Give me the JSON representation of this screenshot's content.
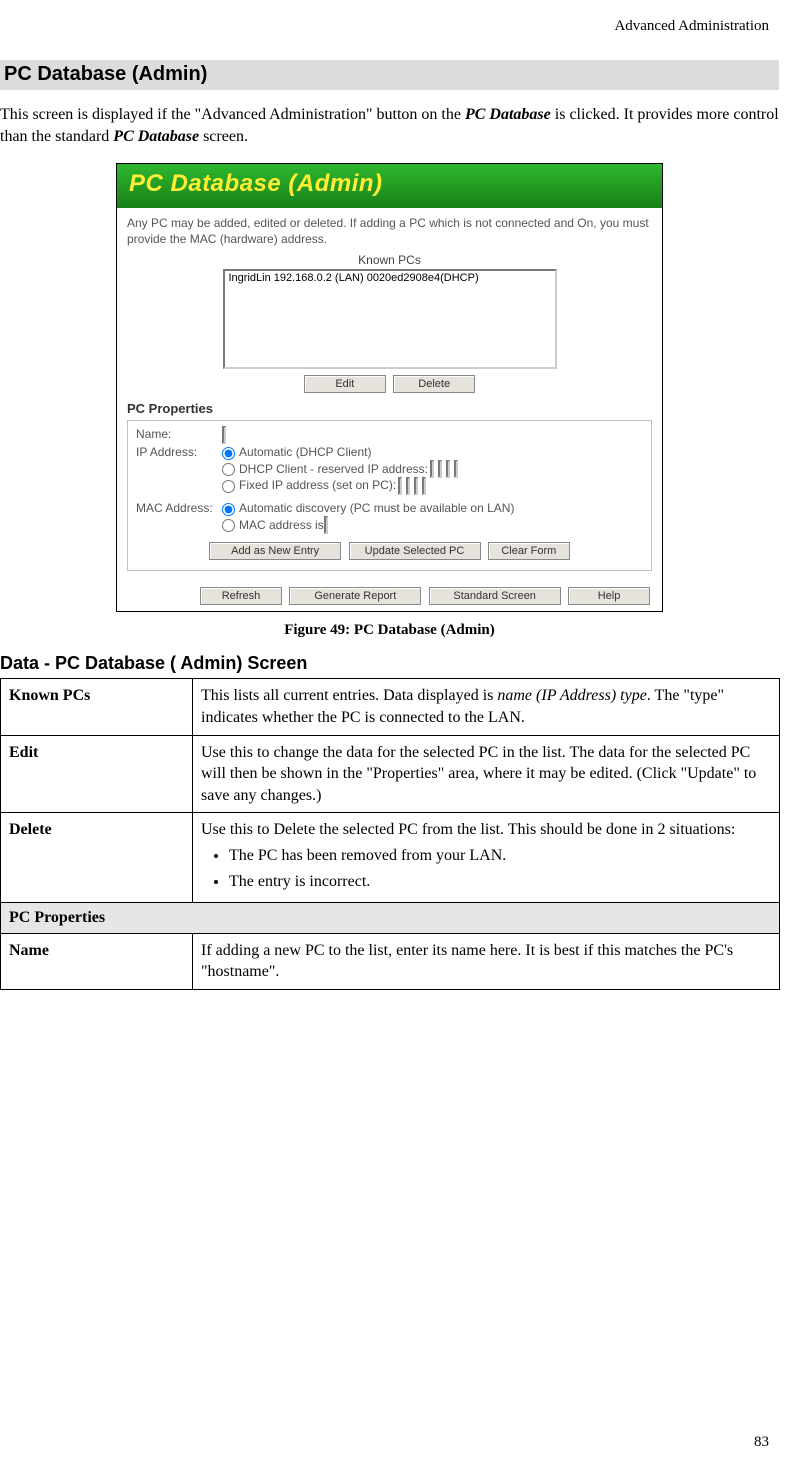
{
  "running_head": "Advanced Administration",
  "page_number": "83",
  "section_title": "PC Database (Admin)",
  "intro_pre": "This screen is displayed if the \"Advanced Administration\" button on the ",
  "intro_bold1": "PC Database",
  "intro_mid": " is clicked. It provides more control than the standard ",
  "intro_bold2": "PC Database",
  "intro_post": " screen.",
  "shot": {
    "header": "PC Database (Admin)",
    "desc": "Any PC may be added, edited or deleted. If adding a PC which is not connected and On, you must provide the MAC (hardware) address.",
    "known_label": "Known PCs",
    "list_item": "IngridLin 192.168.0.2 (LAN) 0020ed2908e4(DHCP)",
    "btn_edit": "Edit",
    "btn_delete": "Delete",
    "pc_props_heading": "PC Properties",
    "name_label": "Name:",
    "ip_label": "IP Address:",
    "ip_opt1": "Automatic (DHCP Client)",
    "ip_opt2": "DHCP Client - reserved IP address:",
    "ip_opt3": "Fixed IP address (set on PC):",
    "mac_label": "MAC Address:",
    "mac_opt1": "Automatic discovery (PC must be available on LAN)",
    "mac_opt2": "MAC address is",
    "btn_add": "Add as New Entry",
    "btn_update": "Update Selected PC",
    "btn_clear": "Clear Form",
    "btn_refresh": "Refresh",
    "btn_report": "Generate Report",
    "btn_standard": "Standard Screen",
    "btn_help": "Help"
  },
  "figure_caption": "Figure 49: PC Database (Admin)",
  "subsection_title": "Data - PC Database ( Admin) Screen",
  "table": {
    "r1_label": "Known PCs",
    "r1_pre": "This lists all current entries. Data displayed is ",
    "r1_italic": "name (IP Address) type",
    "r1_post": ". The \"type\" indicates whether the PC is connected to the LAN.",
    "r2_label": "Edit",
    "r2_desc": "Use this to change the data for the selected PC in the list. The data for the selected PC will then be shown in the \"Properties\" area, where it may be edited. (Click \"Update\" to save any changes.)",
    "r3_label": "Delete",
    "r3_desc": "Use this to Delete the selected PC from the list. This should be done in 2 situations:",
    "r3_b1": "The PC has been removed from your LAN.",
    "r3_b2": "The entry is incorrect.",
    "section_pc_props": "PC Properties",
    "r4_label": "Name",
    "r4_desc": "If adding a new PC to the list, enter its name here. It is best if this matches the PC's \"hostname\"."
  }
}
